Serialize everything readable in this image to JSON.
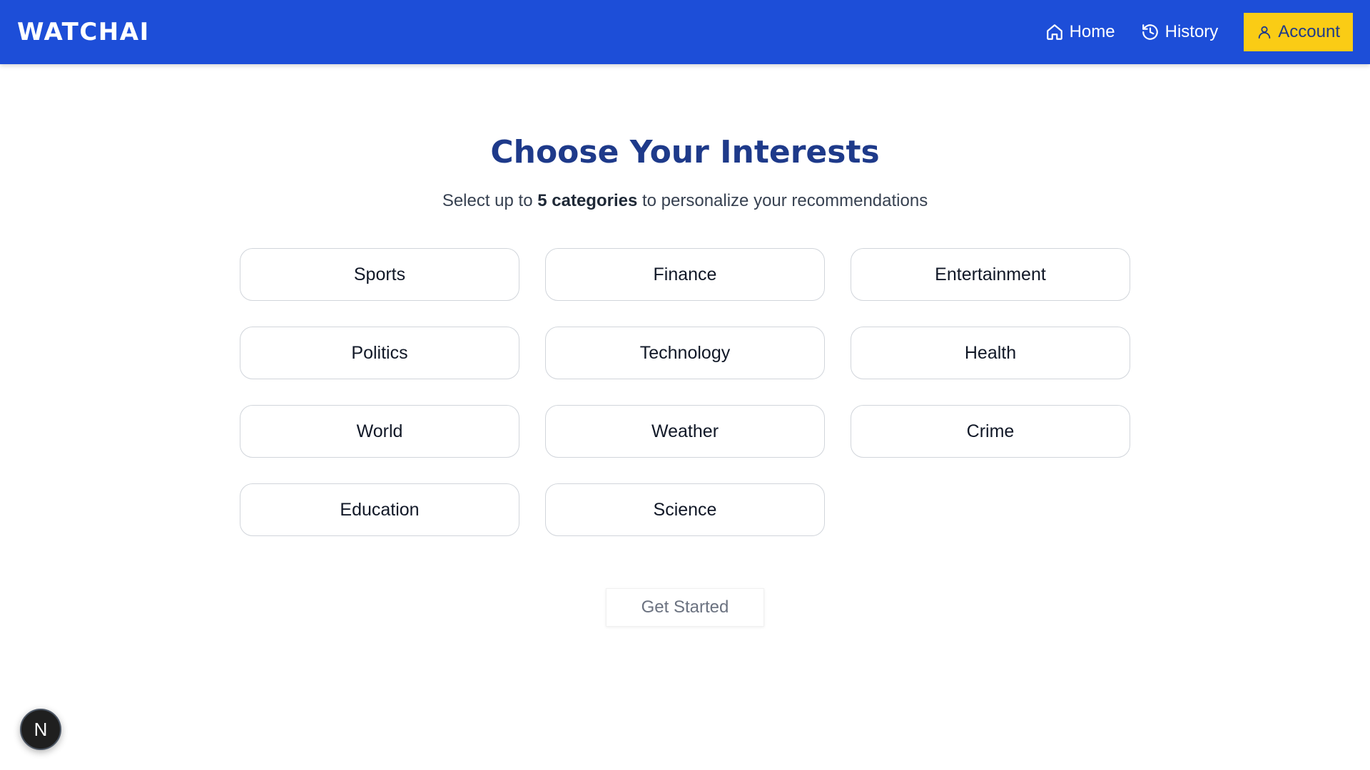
{
  "header": {
    "brand": "WATCHAI",
    "nav": {
      "home": "Home",
      "history": "History",
      "account": "Account"
    },
    "colors": {
      "bar": "#1d4ed8",
      "account_button": "#facc15"
    }
  },
  "main": {
    "title": "Choose Your Interests",
    "subtitle": {
      "before": "Select up to ",
      "emphasis": "5 categories",
      "after": " to personalize your recommendations"
    },
    "categories": [
      "Sports",
      "Finance",
      "Entertainment",
      "Politics",
      "Technology",
      "Health",
      "World",
      "Weather",
      "Crime",
      "Education",
      "Science"
    ],
    "submit_label": "Get Started",
    "submit_disabled": true
  },
  "dev_badge": {
    "label": "N"
  },
  "icons": {
    "home": "home-icon",
    "history": "history-icon",
    "account": "user-icon"
  }
}
